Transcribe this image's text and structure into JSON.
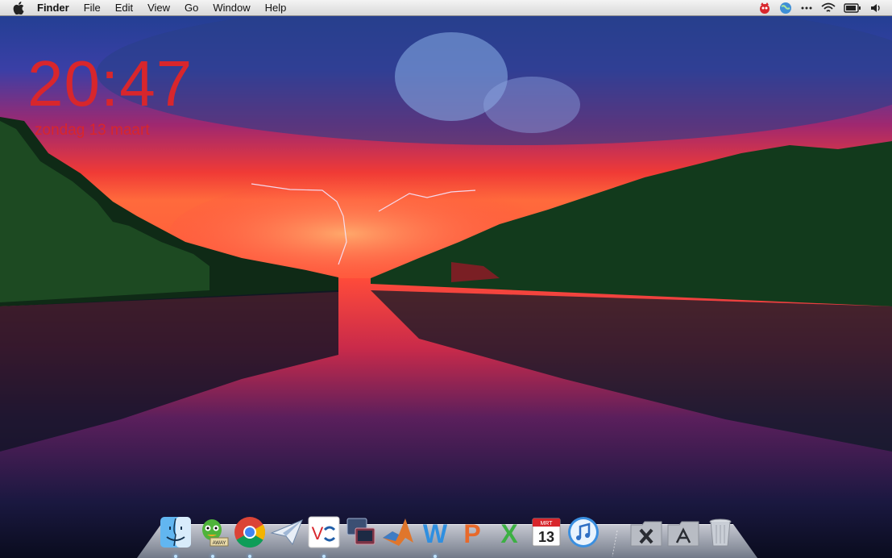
{
  "menubar": {
    "apple_icon": "apple-icon",
    "app_name": "Finder",
    "items": [
      "File",
      "Edit",
      "View",
      "Go",
      "Window",
      "Help"
    ],
    "status_icons": [
      "growl-icon",
      "globe-icon",
      "ellipsis-icon",
      "wifi-icon",
      "battery-icon",
      "volume-icon"
    ]
  },
  "clock": {
    "time": "20:47",
    "date": "zondag 13 maart",
    "color": "#d8262c"
  },
  "dock": {
    "items": [
      {
        "name": "finder-icon"
      },
      {
        "name": "adium-icon",
        "badge": "AWAY"
      },
      {
        "name": "chrome-icon"
      },
      {
        "name": "mail-send-icon"
      },
      {
        "name": "vnc-icon",
        "label": "V"
      },
      {
        "name": "remote-desktop-icon"
      },
      {
        "name": "matlab-icon"
      },
      {
        "name": "word-icon",
        "label": "W"
      },
      {
        "name": "powerpoint-icon",
        "label": "P"
      },
      {
        "name": "excel-icon",
        "label": "X"
      },
      {
        "name": "calendar-icon",
        "month": "MRT",
        "day": "13"
      },
      {
        "name": "itunes-icon"
      },
      {
        "name": "x11-folder-icon"
      },
      {
        "name": "applications-folder-icon"
      },
      {
        "name": "trash-icon"
      }
    ]
  }
}
